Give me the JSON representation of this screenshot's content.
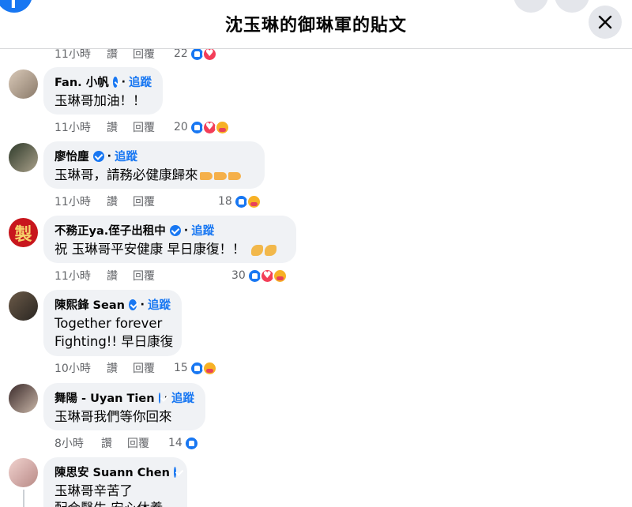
{
  "header": {
    "title": "沈玉琳的御琳軍的貼文"
  },
  "actions": {
    "like": "讚",
    "reply": "回覆"
  },
  "top_meta": {
    "time": "11小時",
    "count": "22"
  },
  "comments": [
    {
      "name": "Fan. 小帆",
      "follow": "追蹤",
      "text": "玉琳哥加油！！",
      "time": "11小時",
      "count": "20"
    },
    {
      "name": "廖怡塵",
      "follow": "追蹤",
      "text": "玉琳哥，請務必健康歸來",
      "time": "11小時",
      "count": "18"
    },
    {
      "name": "不務正ya.侄子出租中",
      "follow": "追蹤",
      "text": "祝 玉琳哥平安健康 早日康復！！",
      "time": "11小時",
      "count": "30"
    },
    {
      "name": "陳熙鋒 Sean",
      "follow": "追蹤",
      "text1": "Together forever",
      "text2": "Fighting!! 早日康復",
      "time": "10小時",
      "count": "15"
    },
    {
      "name": "舞陽 - Uyan Tien",
      "follow": "追蹤",
      "text": "玉琳哥我們等你回來",
      "time": "8小時",
      "count": "14"
    },
    {
      "name": "陳思安 Suann Chen",
      "text1": "玉琳哥辛苦了",
      "text2": "配合醫生 安心休養"
    }
  ],
  "avatar_badge": "製",
  "colors": {
    "accent": "#1877f2",
    "bubble": "#f0f2f5",
    "meta": "#65676b"
  }
}
